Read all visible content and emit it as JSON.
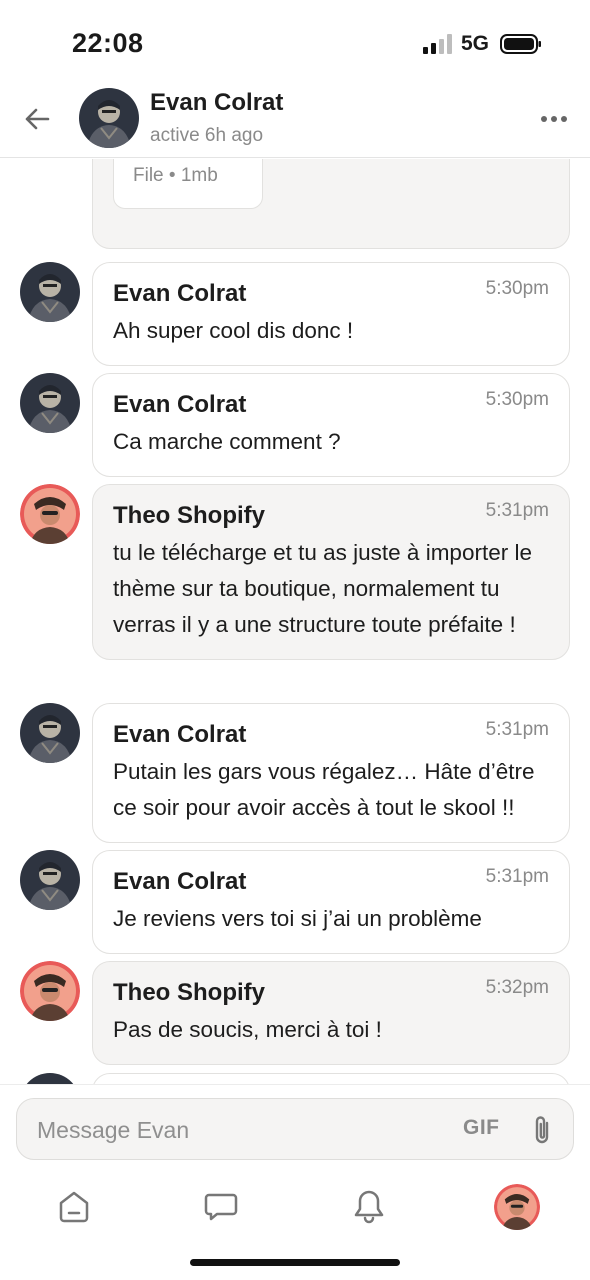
{
  "status_bar": {
    "time": "22:08",
    "network": "5G"
  },
  "header": {
    "name": "Evan Colrat",
    "status": "active 6h ago"
  },
  "file_message": {
    "meta": "File • 1mb"
  },
  "messages": [
    {
      "sender": "Evan Colrat",
      "time": "5:30pm",
      "text": "Ah super cool dis donc !",
      "author": "evan"
    },
    {
      "sender": "Evan Colrat",
      "time": "5:30pm",
      "text": "Ca marche comment ?",
      "author": "evan"
    },
    {
      "sender": "Theo Shopify",
      "time": "5:31pm",
      "text": "tu le télécharge et tu as juste à importer le thème sur ta boutique, normalement tu verras il y a une structure toute préfaite !",
      "author": "theo"
    },
    {
      "sender": "Evan Colrat",
      "time": "5:31pm",
      "text": "Putain les gars vous régalez… Hâte d’être ce soir pour avoir accès à tout le skool !!",
      "author": "evan"
    },
    {
      "sender": "Evan Colrat",
      "time": "5:31pm",
      "text": "Je reviens vers toi si j’ai un problème",
      "author": "evan"
    },
    {
      "sender": "Theo Shopify",
      "time": "5:32pm",
      "text": "Pas de soucis, merci à toi !",
      "author": "theo"
    }
  ],
  "composer": {
    "placeholder": "Message Evan",
    "gif_label": "GIF"
  },
  "colors": {
    "bubble_theo": "#f5f4f3",
    "border": "#e2e1df",
    "muted_text": "#8a8a8a",
    "theo_avatar_ring": "#e85a58"
  },
  "icons": [
    "back-arrow-icon",
    "more-dots-icon",
    "attach-paperclip-icon",
    "home-icon",
    "chat-icon",
    "bell-icon"
  ]
}
